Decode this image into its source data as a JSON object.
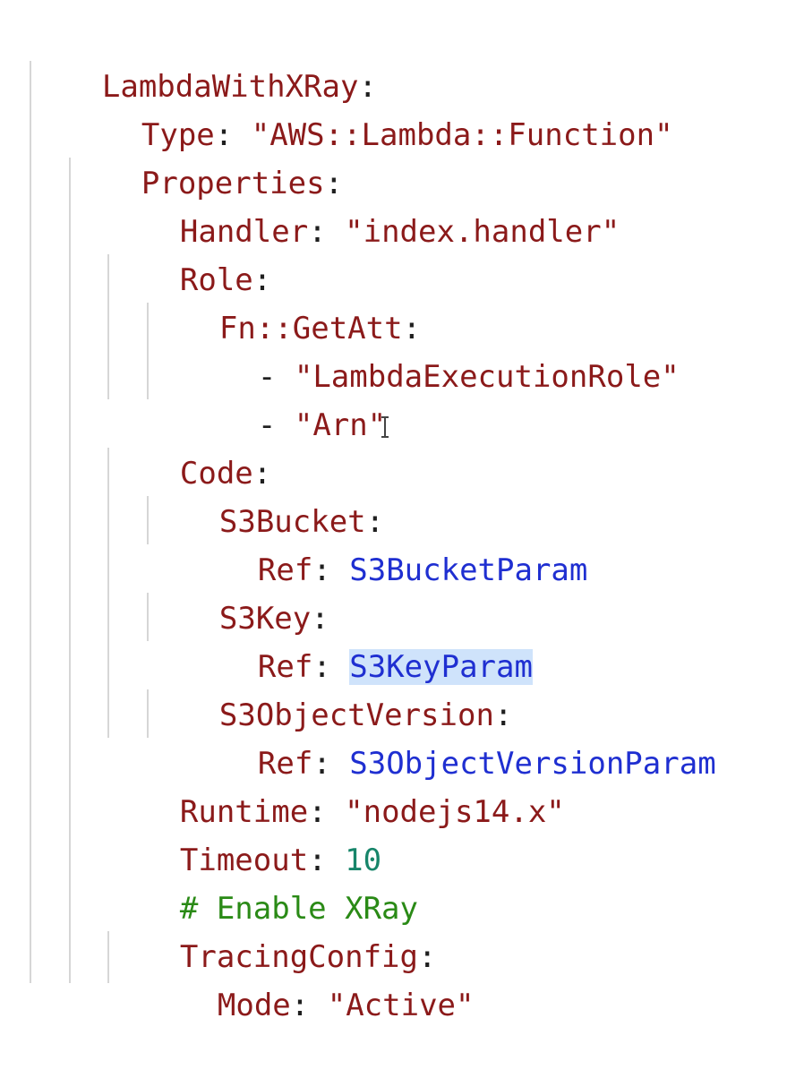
{
  "code": {
    "l01_key": "LambdaWithXRay",
    "l02_key": "Type",
    "l02_val": "\"AWS::Lambda::Function\"",
    "l03_key": "Properties",
    "l04_key": "Handler",
    "l04_val": "\"index.handler\"",
    "l05_key": "Role",
    "l06_key": "Fn::GetAtt",
    "l07_dash": "-",
    "l07_val": "\"LambdaExecutionRole\"",
    "l08_dash": "-",
    "l08_val": "\"Arn\"",
    "l09_key": "Code",
    "l10_key": "S3Bucket",
    "l11_key": "Ref",
    "l11_val": "S3BucketParam",
    "l12_key": "S3Key",
    "l13_key": "Ref",
    "l13_val": "S3KeyParam",
    "l14_key": "S3ObjectVersion",
    "l15_key": "Ref",
    "l15_val": "S3ObjectVersionParam",
    "l16_key": "Runtime",
    "l16_val": "\"nodejs14.x\"",
    "l17_key": "Timeout",
    "l17_val": "10",
    "l18_comment": "# Enable XRay",
    "l19_key": "TracingConfig",
    "l20_key": "Mode",
    "l20_val": "\"Active\""
  },
  "punctuation": {
    "colon": ":",
    "colon_space": ": "
  },
  "colors": {
    "key": "#8b1a1a",
    "ref_value": "#1f2fd1",
    "number": "#17856a",
    "comment": "#2a8a16",
    "selection": "#cfe3fb"
  },
  "icons": {
    "text_cursor": "i-beam-cursor-icon"
  }
}
